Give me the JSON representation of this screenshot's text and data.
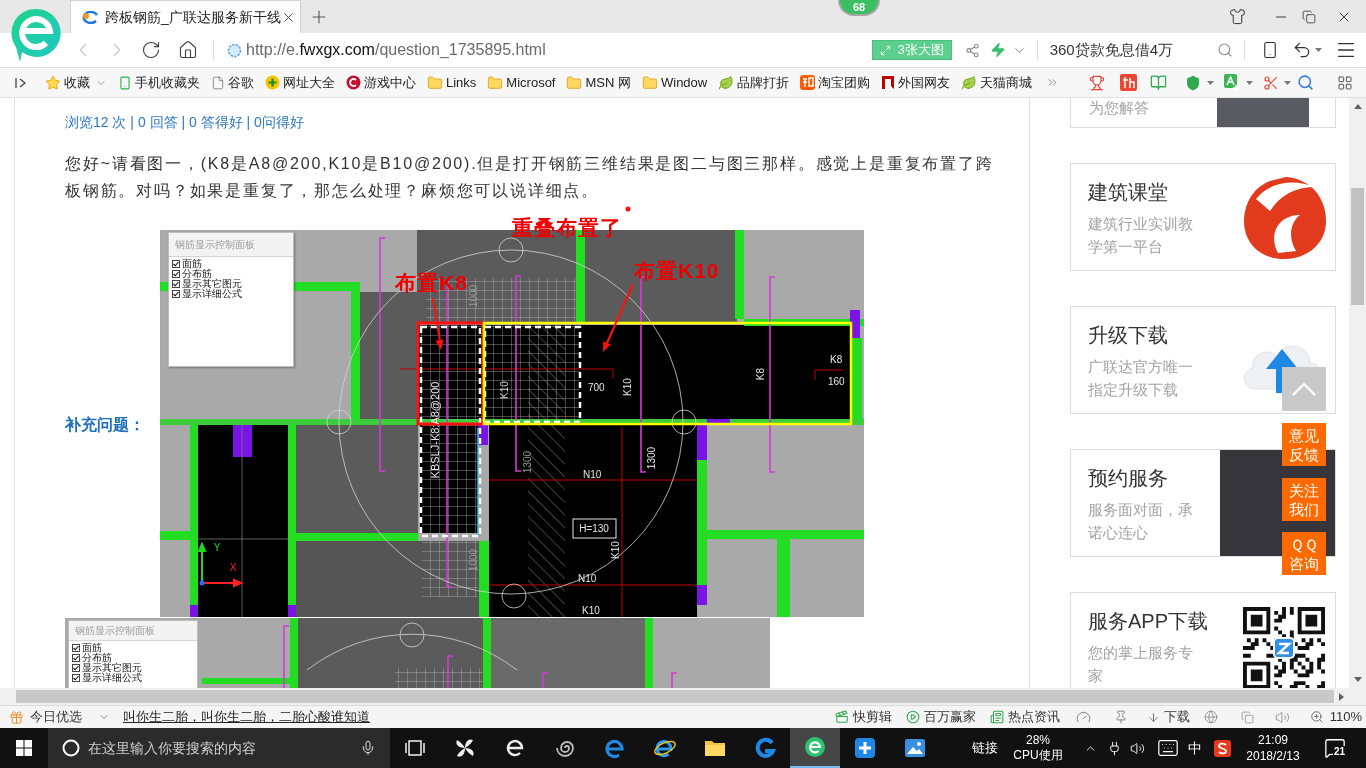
{
  "browser": {
    "tab_title": "跨板钢筋_广联达服务新干线",
    "badge": "68",
    "address": {
      "prefix": "http://e.",
      "domain": "fwxgx.com",
      "path": "/question_1735895.html"
    },
    "big_image_button": "3张大图",
    "search_suggestion": "360贷款免息借4万"
  },
  "bookmarks": [
    {
      "label": "收藏",
      "kind": "favorites"
    },
    {
      "label": "手机收藏夹",
      "kind": "phone"
    },
    {
      "label": "谷歌",
      "kind": "page"
    },
    {
      "label": "网址大全",
      "kind": "sites"
    },
    {
      "label": "游戏中心",
      "kind": "games"
    },
    {
      "label": "Links",
      "kind": "folder"
    },
    {
      "label": "Microsof",
      "kind": "folder"
    },
    {
      "label": "MSN 网",
      "kind": "folder"
    },
    {
      "label": "Window",
      "kind": "folder"
    },
    {
      "label": "品牌打折",
      "kind": "leaf"
    },
    {
      "label": "淘宝团购",
      "kind": "shop"
    },
    {
      "label": "外国网友",
      "kind": "flag"
    },
    {
      "label": "天猫商城",
      "kind": "leaf"
    }
  ],
  "question": {
    "stats": "浏览12 次 | 0 回答 | 0 答得好 | 0问得好",
    "body": "您好~请看图一，(K8是A8@200,K10是B10@200).但是打开钢筋三维结果是图二与图三那样。感觉上是重复布置了跨板钢筋。对吗？如果是重复了，那怎么处理？麻烦您可以说详细点。",
    "supplement_label": "补充问题："
  },
  "figure_1": {
    "annotations": [
      "重叠布置了",
      "布置K8",
      "布置K10"
    ],
    "panel": {
      "title": "钢筋显示控制面板",
      "options": [
        {
          "label": "面筋",
          "checked": true
        },
        {
          "label": "分布筋",
          "checked": true
        },
        {
          "label": "显示其它图元",
          "checked": true
        },
        {
          "label": "显示详细公式",
          "checked": true
        }
      ]
    },
    "labels": [
      "1000",
      "K8",
      "K10",
      "700",
      "K10",
      "K8",
      "160",
      "KBSLJ-K8:A8@200",
      "1300",
      "N10",
      "1300",
      "H=130",
      "1000",
      "K10",
      "N10",
      "K10"
    ],
    "axes": [
      "Y",
      "X"
    ]
  },
  "figure_2": {
    "panel": {
      "title": "钢筋显示控制面板",
      "options": [
        {
          "label": "面筋",
          "checked": true
        },
        {
          "label": "分布筋",
          "checked": true
        },
        {
          "label": "显示其它图元",
          "checked": true
        },
        {
          "label": "显示详细公式",
          "checked": true
        }
      ]
    }
  },
  "sidebar": {
    "top_card": {
      "subtitle": "为您解答"
    },
    "cards": [
      {
        "kind": "logo",
        "title": "建筑课堂",
        "subtitle": "建筑行业实训教学第一平台"
      },
      {
        "kind": "cloud",
        "title": "升级下载",
        "subtitle": "广联达官方唯一指定升级下载"
      },
      {
        "kind": "photo",
        "title": "预约服务",
        "subtitle": "服务面对面，承诺心连心"
      },
      {
        "kind": "qr",
        "title": "服务APP下载",
        "subtitle": "您的掌上服务专家"
      }
    ],
    "float_buttons": [
      "意见反馈",
      "关注我们",
      "ＱＱ咨询"
    ]
  },
  "status_bar": {
    "today": "今日优选",
    "headline": "叫你生二胎，叫你生二胎，二胎心酸谁知道",
    "tools": [
      {
        "label": "快剪辑",
        "kind": "clip"
      },
      {
        "label": "百万赢家",
        "kind": "play"
      },
      {
        "label": "热点资讯",
        "kind": "news"
      }
    ],
    "download": "下载",
    "zoom": "110%"
  },
  "taskbar": {
    "search_placeholder": "在这里输入你要搜索的内容",
    "apps": [
      {
        "kind": "pinwheel",
        "selected": false
      },
      {
        "kind": "outline-e",
        "selected": false
      },
      {
        "kind": "spiral",
        "selected": false
      },
      {
        "kind": "edge",
        "selected": false
      },
      {
        "kind": "ie",
        "selected": false
      },
      {
        "kind": "folder",
        "selected": false
      },
      {
        "kind": "g-app",
        "selected": false
      },
      {
        "kind": "browser360",
        "selected": true
      },
      {
        "kind": "plus-app",
        "selected": false
      },
      {
        "kind": "photo-app",
        "selected": false
      }
    ],
    "link": "链接",
    "cpu_percent": "28%",
    "cpu_label": "CPU使用",
    "ime": "中",
    "time": "21:09",
    "date": "2018/2/13",
    "notifications": "21"
  }
}
